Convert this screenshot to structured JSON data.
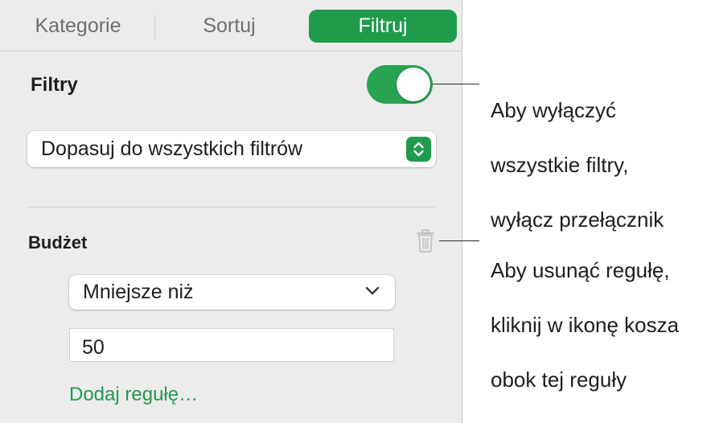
{
  "tabs": {
    "kategorie": "Kategorie",
    "sortuj": "Sortuj",
    "filtruj": "Filtruj"
  },
  "filters": {
    "label": "Filtry",
    "toggle_on": true,
    "match_select_value": "Dopasuj do wszystkich filtrów"
  },
  "rule": {
    "column": "Budżet",
    "condition": "Mniejsze niż",
    "value": "50",
    "add_rule_label": "Dodaj regułę…"
  },
  "callouts": {
    "toggle_line1": "Aby wyłączyć",
    "toggle_line2": "wszystkie filtry,",
    "toggle_line3": "wyłącz przełącznik",
    "trash_line1": "Aby usunąć regułę,",
    "trash_line2": "kliknij w ikonę kosza",
    "trash_line3": "obok tej reguły"
  },
  "colors": {
    "accent": "#1f9b4c",
    "panel_background": "#ececec"
  },
  "icons": {
    "trash": "trash-icon",
    "chevron": "chevron-down-icon",
    "stepper": "up-down-stepper-icon"
  }
}
